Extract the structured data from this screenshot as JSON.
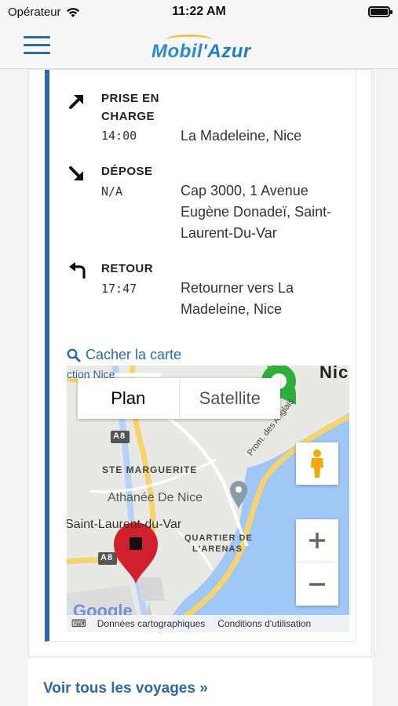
{
  "status_bar": {
    "carrier": "Opérateur",
    "time": "11:22 AM"
  },
  "header": {
    "logo_part1": "Mobil'",
    "logo_part2": "Azur"
  },
  "trip": {
    "stops": [
      {
        "icon": "arrow-up-right-icon",
        "title": "PRISE EN CHARGE",
        "time": "14:00",
        "address": "La Madeleine, Nice"
      },
      {
        "icon": "arrow-down-right-icon",
        "title": "DÉPOSE",
        "time": "N/A",
        "address": "Cap 3000, 1 Avenue Eugène Donadeï, Saint-Laurent-Du-Var"
      },
      {
        "icon": "return-arrow-icon",
        "title": "RETOUR",
        "time": "17:47",
        "address": "Retourner vers La Madeleine, Nice"
      }
    ],
    "map_toggle_label": "Cacher la carte"
  },
  "map": {
    "type_plan": "Plan",
    "type_satellite": "Satellite",
    "labels": {
      "city": "Nic",
      "station": "ction Nice",
      "road_a8_1": "A8",
      "road_a8_2": "A8",
      "marguerite": "STE MARGUERITE",
      "athanee": "Athanée De Nice",
      "promenade": "Prom. des Anglais",
      "saint_laurent": "Saint-Laurent-du-Var",
      "quartier_1": "QUARTIER DE",
      "quartier_2": "L'ARENAS"
    },
    "footer_data": "Données cartographiques",
    "footer_terms": "Conditions d'utilisation",
    "google": "Google"
  },
  "footer": {
    "all_trips_link": "Voir tous les voyages »"
  }
}
